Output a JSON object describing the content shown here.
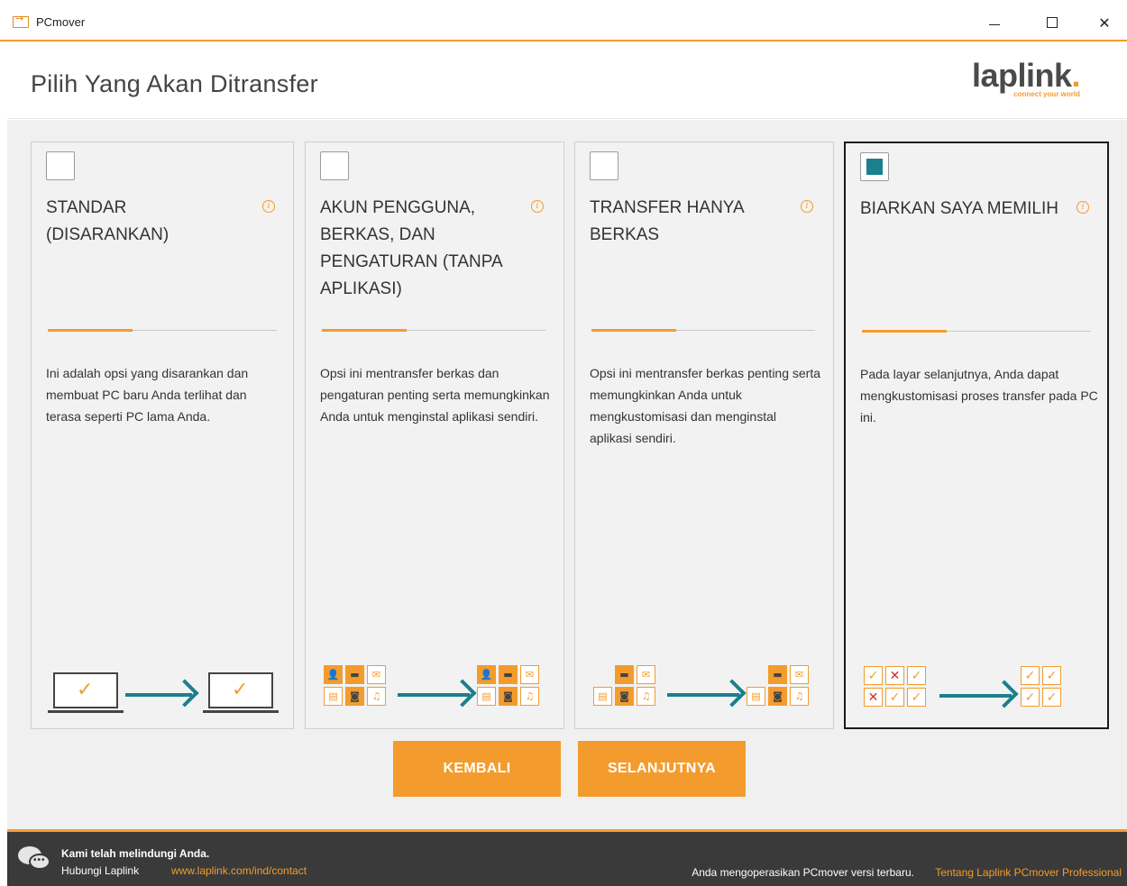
{
  "window": {
    "title": "PCmover",
    "minimize": "–",
    "maximize": "☐",
    "close": "✕"
  },
  "header": {
    "title": "Pilih Yang Akan Ditransfer",
    "logo_text": "laplink",
    "logo_dot": ".",
    "logo_tagline": "connect your world"
  },
  "options": [
    {
      "title": "STANDAR (DISARANKAN)",
      "description": "Ini adalah opsi yang disarankan dan membuat PC baru Anda terlihat dan terasa seperti PC lama Anda.",
      "checked": false
    },
    {
      "title": "AKUN PENGGUNA, BERKAS, DAN PENGATURAN (TANPA APLIKASI)",
      "description": "Opsi ini mentransfer berkas dan pengaturan penting serta memungkinkan Anda untuk menginstal aplikasi sendiri.",
      "checked": false
    },
    {
      "title": "TRANSFER HANYA BERKAS",
      "description": "Opsi ini mentransfer berkas penting serta memungkinkan Anda untuk mengkustomisasi dan menginstal aplikasi sendiri.",
      "checked": false
    },
    {
      "title": "BIARKAN SAYA MEMILIH",
      "description": "Pada layar selanjutnya, Anda dapat mengkustomisasi proses transfer pada PC ini.",
      "checked": true
    }
  ],
  "buttons": {
    "back": "KEMBALI",
    "next": "SELANJUTNYA"
  },
  "footer": {
    "protect": "Kami telah melindungi Anda.",
    "contact_label": "Hubungi Laplink",
    "contact_link": "www.laplink.com/ind/contact",
    "version_note": "Anda mengoperasikan PCmover versi terbaru.",
    "about_link": "Tentang Laplink PCmover Professional"
  },
  "colors": {
    "accent": "#f39c2d",
    "teal": "#1a7f8e",
    "footer_bg": "#3a3a3a"
  },
  "icons": {
    "info": "info-icon",
    "laptop": "laptop-icon",
    "arrow": "arrow-right-icon",
    "user": "user-icon",
    "folder": "folder-icon",
    "mail": "mail-icon",
    "document": "document-icon",
    "photo": "photo-icon",
    "music": "music-icon",
    "chat": "chat-icon"
  }
}
